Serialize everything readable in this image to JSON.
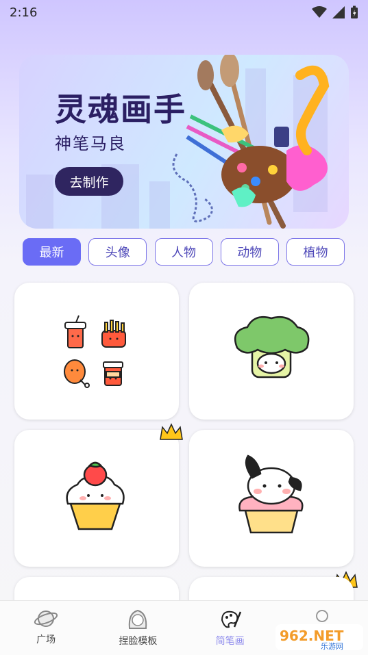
{
  "status": {
    "time": "2:16"
  },
  "banner": {
    "title": "灵魂画手",
    "subtitle": "神笔马良",
    "button": "去制作"
  },
  "tabs": [
    "最新",
    "头像",
    "人物",
    "动物",
    "植物"
  ],
  "nav": {
    "items": [
      "广场",
      "捏脸模板",
      "简笔画",
      ""
    ],
    "active_index": 2
  },
  "watermark": {
    "logo": "962.NET",
    "sub": "乐游网"
  },
  "colors": {
    "accent": "#6a6cf5",
    "nav_active": "#8c89ec",
    "banner_button": "#2f2560"
  }
}
